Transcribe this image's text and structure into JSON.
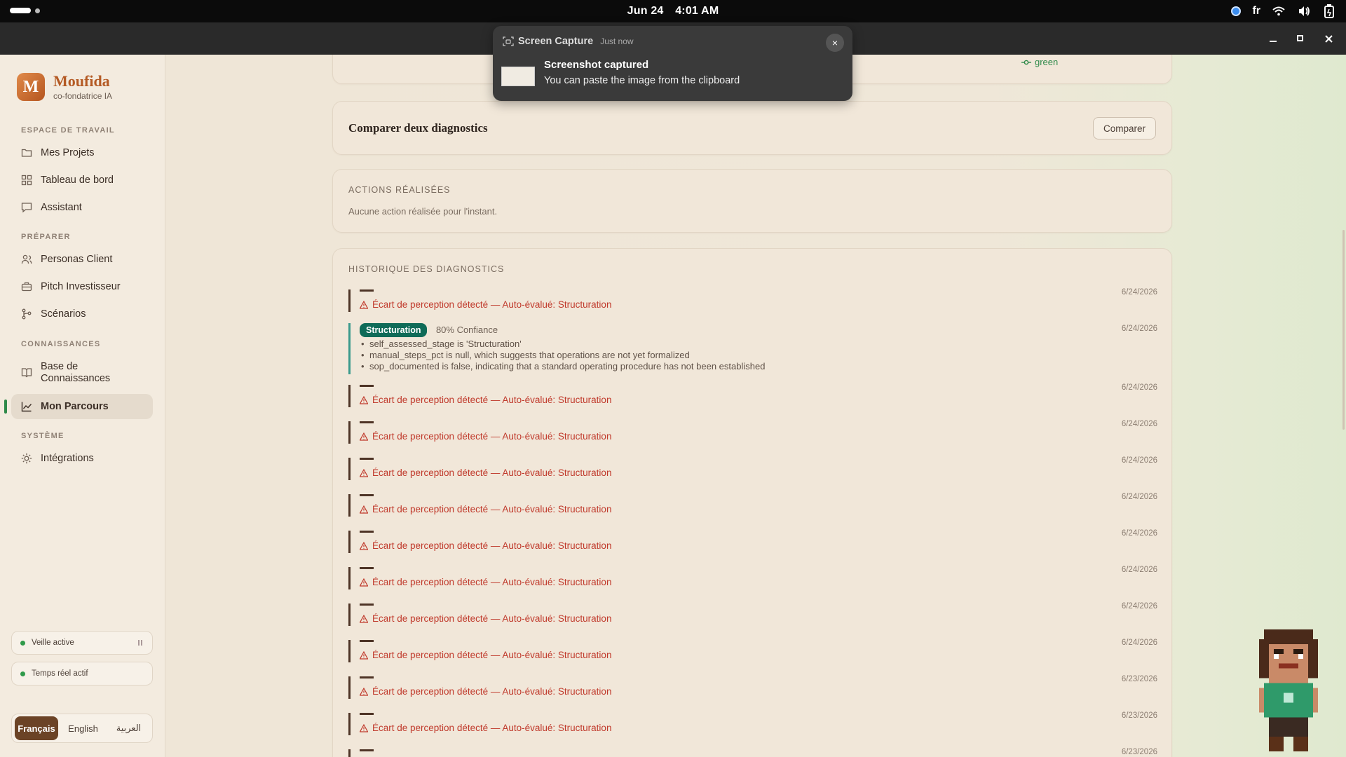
{
  "system_bar": {
    "date": "Jun 24",
    "time": "4:01 AM",
    "language": "fr",
    "icons": [
      "indicator-dot-icon",
      "wifi-icon",
      "volume-icon",
      "battery-icon"
    ]
  },
  "window": {
    "controls": [
      "minimize-icon",
      "maximize-icon",
      "close-icon"
    ]
  },
  "toast": {
    "app": "Screen Capture",
    "when": "Just now",
    "title": "Screenshot captured",
    "body": "You can paste the image from the clipboard",
    "close_label": "×"
  },
  "sidebar": {
    "brand": {
      "initial": "M",
      "name": "Moufida",
      "subtitle": "co-fondatrice IA"
    },
    "sections": [
      {
        "label": "ESPACE DE TRAVAIL",
        "items": [
          {
            "label": "Mes Projets",
            "icon": "folder-icon"
          },
          {
            "label": "Tableau de bord",
            "icon": "grid-icon"
          },
          {
            "label": "Assistant",
            "icon": "chat-icon"
          }
        ]
      },
      {
        "label": "PRÉPARER",
        "items": [
          {
            "label": "Personas Client",
            "icon": "users-icon"
          },
          {
            "label": "Pitch Investisseur",
            "icon": "briefcase-icon"
          },
          {
            "label": "Scénarios",
            "icon": "branch-icon"
          }
        ]
      },
      {
        "label": "CONNAISSANCES",
        "items": [
          {
            "label": "Base de Connaissances",
            "icon": "book-icon"
          },
          {
            "label": "Mon Parcours",
            "icon": "trend-icon",
            "active": true
          }
        ]
      },
      {
        "label": "SYSTÈME",
        "items": [
          {
            "label": "Intégrations",
            "icon": "sun-gear-icon"
          }
        ]
      }
    ],
    "status": [
      {
        "label": "Veille active",
        "color": "#2f9a4a"
      },
      {
        "label": "Temps réel actif",
        "color": "#2f9a4a"
      }
    ],
    "languages": [
      {
        "label": "Français",
        "active": true
      },
      {
        "label": "English"
      },
      {
        "label": "العربية"
      }
    ]
  },
  "main": {
    "top_card": {
      "tag": "green"
    },
    "compare": {
      "title": "Comparer deux diagnostics",
      "button": "Comparer"
    },
    "actions": {
      "label": "ACTIONS RÉALISÉES",
      "empty": "Aucune action réalisée pour l'instant."
    },
    "history": {
      "label": "HISTORIQUE DES DIAGNOSTICS",
      "rows": [
        {
          "type": "warning",
          "text": "Écart de perception détecté — Auto-évalué: Structuration",
          "date": "6/24/2026"
        },
        {
          "type": "diagnostic",
          "badge": "Structuration",
          "confidence": "80% Confiance",
          "date": "6/24/2026",
          "bullets": [
            "self_assessed_stage is 'Structuration'",
            "manual_steps_pct is null, which suggests that operations are not yet formalized",
            "sop_documented is false, indicating that a standard operating procedure has not been established"
          ]
        },
        {
          "type": "warning",
          "text": "Écart de perception détecté — Auto-évalué: Structuration",
          "date": "6/24/2026"
        },
        {
          "type": "warning",
          "text": "Écart de perception détecté — Auto-évalué: Structuration",
          "date": "6/24/2026"
        },
        {
          "type": "warning",
          "text": "Écart de perception détecté — Auto-évalué: Structuration",
          "date": "6/24/2026"
        },
        {
          "type": "warning",
          "text": "Écart de perception détecté — Auto-évalué: Structuration",
          "date": "6/24/2026"
        },
        {
          "type": "warning",
          "text": "Écart de perception détecté — Auto-évalué: Structuration",
          "date": "6/24/2026"
        },
        {
          "type": "warning",
          "text": "Écart de perception détecté — Auto-évalué: Structuration",
          "date": "6/24/2026"
        },
        {
          "type": "warning",
          "text": "Écart de perception détecté — Auto-évalué: Structuration",
          "date": "6/24/2026"
        },
        {
          "type": "warning",
          "text": "Écart de perception détecté — Auto-évalué: Structuration",
          "date": "6/24/2026"
        },
        {
          "type": "warning",
          "text": "Écart de perception détecté — Auto-évalué: Structuration",
          "date": "6/23/2026"
        },
        {
          "type": "warning",
          "text": "Écart de perception détecté — Auto-évalué: Structuration",
          "date": "6/23/2026"
        },
        {
          "type": "warning",
          "text": "",
          "date": "6/23/2026"
        }
      ]
    }
  }
}
